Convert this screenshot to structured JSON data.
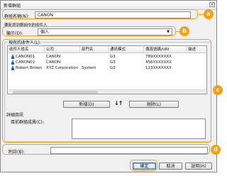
{
  "window": {
    "title": "新增群組",
    "close_glyph": "×"
  },
  "group_name": {
    "label": "群組名稱(N):",
    "value": "CANON"
  },
  "display_section": {
    "title": "要新增到群組中的收件人",
    "label": "顯示(D):",
    "selected": "個人"
  },
  "recipients": {
    "title": "現有的收件人(L):",
    "columns": [
      "收件人姓名",
      "公司",
      "部門名",
      "通訊模式",
      "傳真號碼/URI",
      "描述"
    ],
    "rows": [
      [
        "CANON01",
        "CANON",
        "",
        "G3",
        "789XXXXXXX"
      ],
      [
        "CANON02",
        "CANON",
        "",
        "G3",
        "456XXXXXXX"
      ],
      [
        "Robert Brown",
        "XYZ Corporation",
        "System",
        "G3",
        "123XXXXXXX"
      ]
    ]
  },
  "buttons": {
    "add": "新增(D)",
    "arrows": "↓↑",
    "remove": "刪除(L)"
  },
  "detail": {
    "title": "詳細資訊",
    "members_label": "目前群組成員(C):"
  },
  "note": {
    "label": "附註(B):",
    "value": ""
  },
  "footer": {
    "ok": "確定",
    "cancel": "取消",
    "help": "說明(H)"
  },
  "callouts": {
    "a": "a",
    "b": "b",
    "c": "c",
    "d": "d"
  },
  "colors": {
    "highlight": "#f0a21a",
    "user_icon": "#2a5fb0"
  }
}
